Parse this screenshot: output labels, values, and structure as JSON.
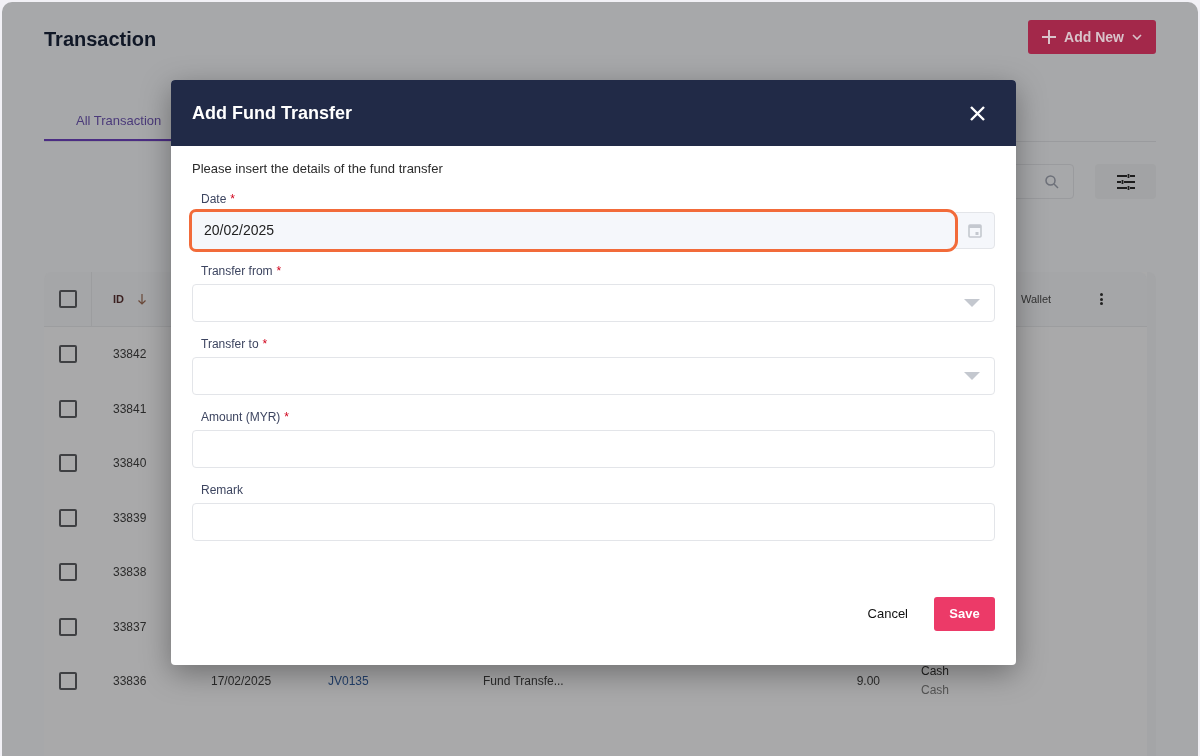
{
  "page": {
    "title": "Transaction",
    "add_button": "Add New",
    "tabs": [
      {
        "label": "All Transaction",
        "selected": true
      }
    ]
  },
  "table": {
    "select_all": {
      "checked": false
    },
    "columns": [
      {
        "label": "ID",
        "sorted": true
      },
      {
        "label": "Wallet"
      }
    ],
    "rows": [
      {
        "id": "33842",
        "checked": false
      },
      {
        "id": "33841",
        "checked": false
      },
      {
        "id": "33840",
        "checked": false
      },
      {
        "id": "33839",
        "checked": false
      },
      {
        "id": "33838",
        "checked": false
      },
      {
        "id": "33837",
        "checked": false
      },
      {
        "id": "33836",
        "checked": false,
        "date": "17/02/2025",
        "reference": "JV0135",
        "type": "Fund Transfe...",
        "amount": "9.00",
        "wallet_from": "Cash",
        "wallet_to": "Cash"
      }
    ]
  },
  "dialog": {
    "title": "Add Fund Transfer",
    "required_marker": "*",
    "intro": "Please insert the details of the fund transfer",
    "fields": [
      {
        "kind": "date",
        "label": "Date",
        "required": true,
        "value": "20/02/2025",
        "highlighted": true
      },
      {
        "kind": "select",
        "label": "Transfer from",
        "required": true,
        "highlighted": false
      },
      {
        "kind": "select",
        "label": "Transfer to",
        "required": true,
        "highlighted": false
      },
      {
        "kind": "text",
        "label": "Amount (MYR)",
        "required": true,
        "highlighted": false
      },
      {
        "kind": "text",
        "label": "Remark",
        "required": false,
        "highlighted": false
      }
    ],
    "buttons": [
      {
        "kind": "cancel",
        "label": "Cancel"
      },
      {
        "kind": "save",
        "label": "Save"
      }
    ]
  }
}
